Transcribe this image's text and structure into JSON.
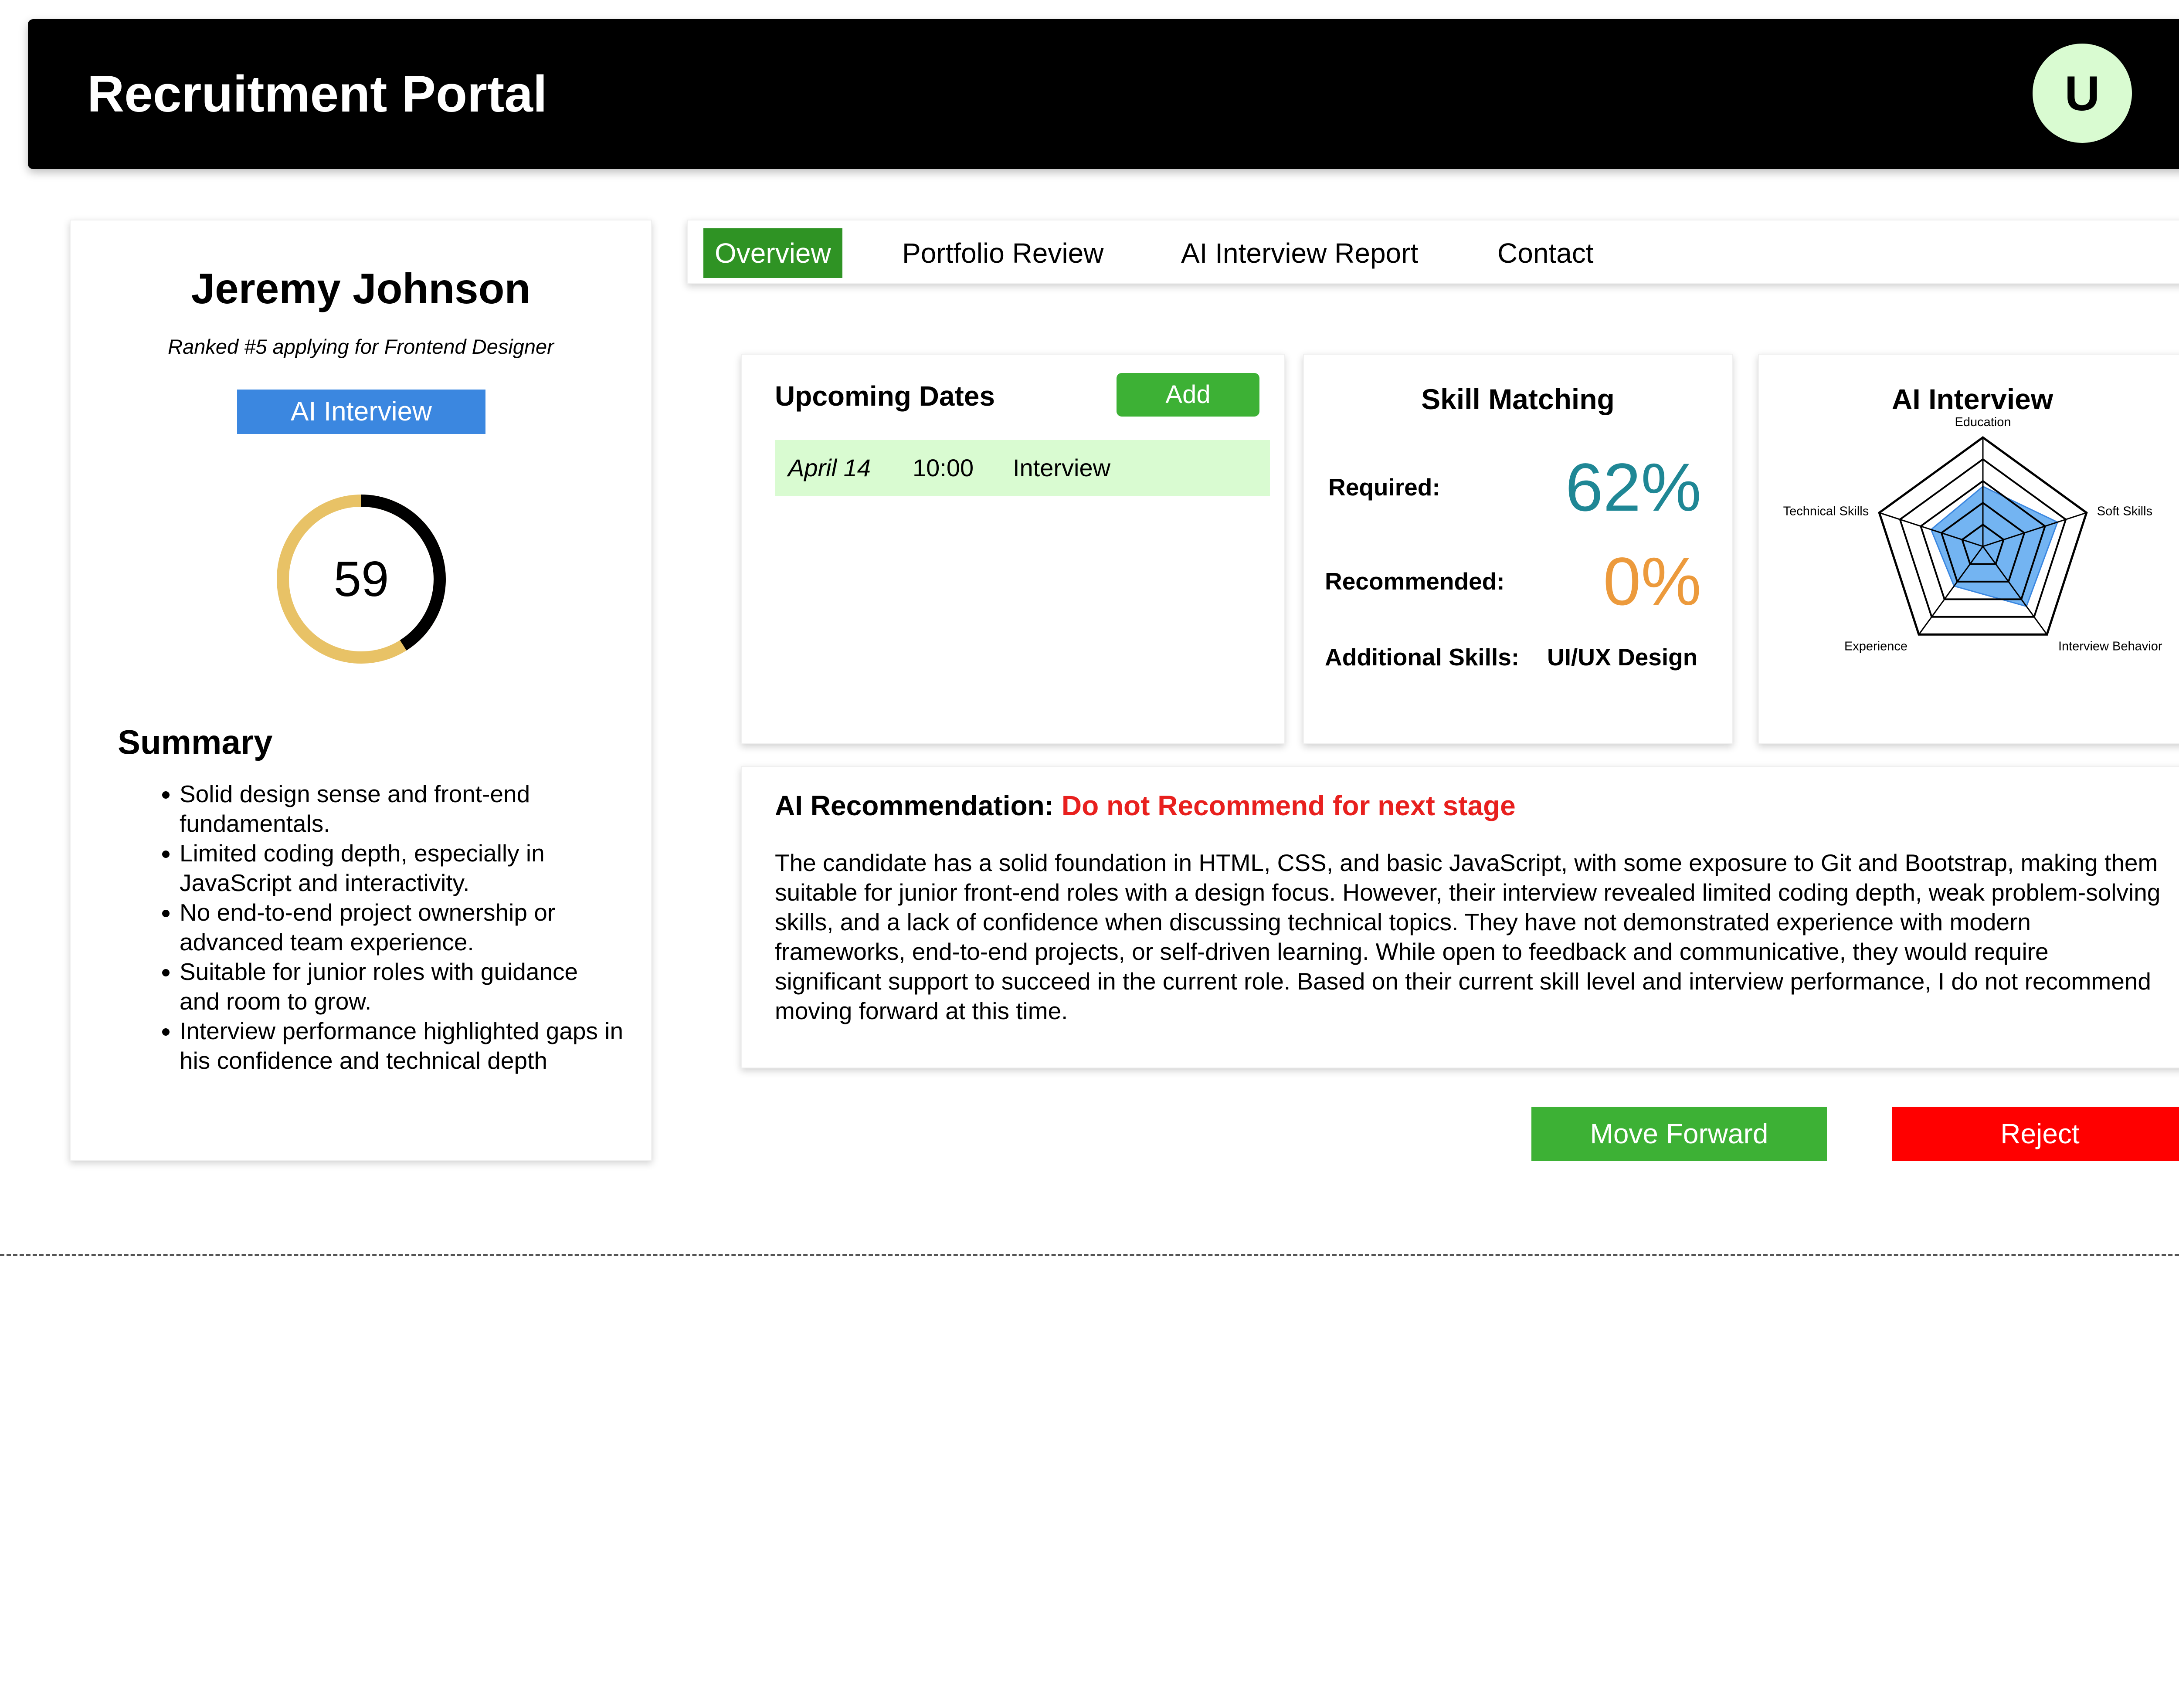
{
  "header": {
    "title": "Recruitment Portal",
    "avatar_initial": "U"
  },
  "candidate": {
    "name": "Jeremy Johnson",
    "subtitle": "Ranked #5 applying for Frontend Designer",
    "badge": "AI Interview",
    "score": "59",
    "score_value": 59,
    "score_max": 100
  },
  "summary": {
    "title": "Summary",
    "items": [
      "Solid design sense and front-end fundamentals.",
      "Limited coding depth, especially in JavaScript and interactivity.",
      "No end-to-end project ownership or advanced team experience.",
      "Suitable for junior roles with guidance and room to grow.",
      "Interview performance highlighted gaps in his confidence and technical depth"
    ]
  },
  "tabs": [
    {
      "label": "Overview",
      "active": true
    },
    {
      "label": "Portfolio Review",
      "active": false
    },
    {
      "label": "AI Interview Report",
      "active": false
    },
    {
      "label": "Contact",
      "active": false
    }
  ],
  "dates": {
    "title": "Upcoming Dates",
    "add_label": "Add",
    "rows": [
      {
        "date": "April 14",
        "time": "10:00",
        "event": "Interview"
      }
    ]
  },
  "skills": {
    "title": "Skill Matching",
    "required_label": "Required:",
    "required_value": "62%",
    "recommended_label": "Recommended:",
    "recommended_value": "0%",
    "additional_label": "Additional Skills:",
    "additional_value": "UI/UX Design"
  },
  "radar": {
    "title": "AI Interview",
    "axes": [
      "Education",
      "Soft Skills",
      "Interview Behavior",
      "Experience",
      "Technical Skills"
    ],
    "values": [
      0.55,
      0.72,
      0.68,
      0.45,
      0.5
    ]
  },
  "recommendation": {
    "label": "AI Recommendation:",
    "verdict": "Do not Recommend for next stage",
    "body": "The candidate has a solid foundation in HTML, CSS, and basic JavaScript, with some exposure to Git and Bootstrap, making them suitable for junior front-end roles with a design focus. However, their interview revealed limited coding depth, weak problem-solving skills, and a lack of confidence when discussing technical topics. They have not demonstrated experience with modern frameworks, end-to-end projects, or self-driven learning. While open to feedback and communicative, they would require significant support to succeed in the current role. Based on their current skill level and interview performance, I do not recommend moving forward at this time."
  },
  "actions": {
    "forward_label": "Move Forward",
    "reject_label": "Reject"
  },
  "colors": {
    "header_bg": "#000000",
    "avatar_bg": "#d9fbd1",
    "active_tab": "#2f9324",
    "badge_blue": "#3b87e0",
    "success": "#3db135",
    "danger": "#ff0000",
    "required_teal": "#1f8795",
    "recommended_orange": "#ec9a3c",
    "ring_gold": "#e8c266",
    "radar_fill": "#5aa7f0"
  }
}
